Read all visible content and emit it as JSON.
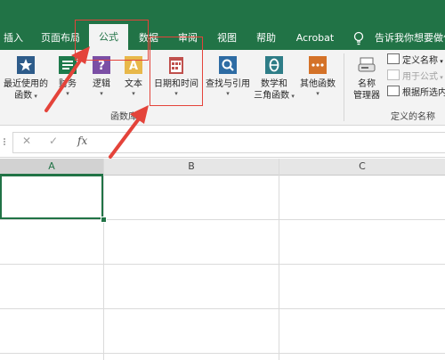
{
  "tabs": [
    {
      "label": "插入"
    },
    {
      "label": "页面布局"
    },
    {
      "label": "公式"
    },
    {
      "label": "数据"
    },
    {
      "label": "审阅"
    },
    {
      "label": "视图"
    },
    {
      "label": "帮助"
    },
    {
      "label": "Acrobat"
    }
  ],
  "tell_me": {
    "text": "告诉我你想要做什"
  },
  "ribbon": {
    "function_library": {
      "group_label": "函数库",
      "buttons": [
        {
          "line1": "最近使用的",
          "line2": "函数",
          "icon": "star-icon",
          "color": "#2e5c8a"
        },
        {
          "line1": "财务",
          "line2": "",
          "icon": "finance-icon",
          "color": "#1e7a4c"
        },
        {
          "line1": "逻辑",
          "line2": "",
          "icon": "question-icon",
          "color": "#7b4fa5"
        },
        {
          "line1": "文本",
          "line2": "",
          "icon": "text-icon",
          "color": "#d8a23a"
        },
        {
          "line1": "日期和时间",
          "line2": "",
          "icon": "calendar-icon",
          "color": "#c0504d"
        },
        {
          "line1": "查找与引用",
          "line2": "",
          "icon": "lookup-icon",
          "color": "#2e6ca4"
        },
        {
          "line1": "数学和",
          "line2": "三角函数",
          "icon": "theta-icon",
          "color": "#2e7d87"
        },
        {
          "line1": "其他函数",
          "line2": "",
          "icon": "more-functions-icon",
          "color": "#d47228"
        }
      ]
    },
    "defined_names": {
      "group_label": "定义的名称",
      "name_manager": {
        "line1": "名称",
        "line2": "管理器"
      },
      "define_name": "定义名称",
      "use_in_formula": "用于公式",
      "create_from_selection": "根据所选内容"
    }
  },
  "formula_bar": {
    "cancel": "✕",
    "enter": "✓",
    "fx": "fx",
    "value": ""
  },
  "columns": [
    {
      "label": "A"
    },
    {
      "label": "B"
    },
    {
      "label": "C"
    }
  ],
  "colors": {
    "excel_green": "#217346",
    "annotation_red": "#e4433a"
  }
}
